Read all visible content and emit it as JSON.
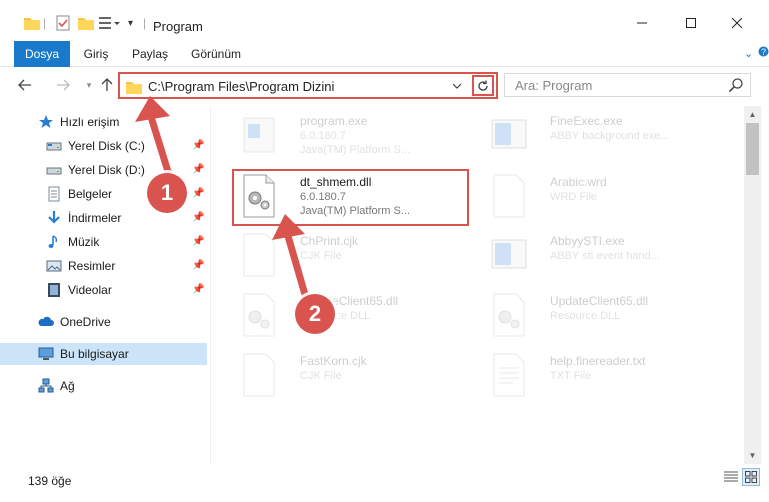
{
  "window": {
    "title": "Program",
    "minimize_icon": "minimize-icon",
    "maximize_icon": "maximize-icon",
    "close_icon": "close-icon"
  },
  "ribbon": {
    "tabs": [
      {
        "label": "Dosya",
        "active": true
      },
      {
        "label": "Giriş",
        "active": false
      },
      {
        "label": "Paylaş",
        "active": false
      },
      {
        "label": "Görünüm",
        "active": false
      }
    ]
  },
  "address": {
    "path": "C:\\Program Files\\Program Dizini",
    "search_placeholder": "Ara: Program"
  },
  "sidebar": {
    "items": [
      {
        "label": "Hızlı erişim",
        "icon": "star-icon",
        "pinned": false
      },
      {
        "label": "Yerel Disk (C:)",
        "icon": "drive-icon",
        "pinned": true
      },
      {
        "label": "Yerel Disk (D:)",
        "icon": "drive-icon",
        "pinned": true
      },
      {
        "label": "Belgeler",
        "icon": "documents-icon",
        "pinned": true
      },
      {
        "label": "İndirmeler",
        "icon": "download-icon",
        "pinned": true
      },
      {
        "label": "Müzik",
        "icon": "music-icon",
        "pinned": true
      },
      {
        "label": "Resimler",
        "icon": "pictures-icon",
        "pinned": true
      },
      {
        "label": "Videolar",
        "icon": "videos-icon",
        "pinned": true
      },
      {
        "label": "OneDrive",
        "icon": "cloud-icon",
        "pinned": false
      },
      {
        "label": "Bu bilgisayar",
        "icon": "computer-icon",
        "pinned": false,
        "selected": true
      },
      {
        "label": "Ağ",
        "icon": "network-icon",
        "pinned": false
      }
    ]
  },
  "files": [
    {
      "name": "program.exe",
      "line1": "6.0.180.7",
      "line2": "Java(TM) Platform S...",
      "faded": true
    },
    {
      "name": "FineExec.exe",
      "line1": "ABBY background exe...",
      "line2": "",
      "faded": true
    },
    {
      "name": "dt_shmem.dll",
      "line1": "6.0.180.7",
      "line2": "Java(TM) Platform S...",
      "faded": false
    },
    {
      "name": "Arabic.wrd",
      "line1": "WRD File",
      "line2": "",
      "faded": true
    },
    {
      "name": "ChPrint.cjk",
      "line1": "CJK File",
      "line2": "",
      "faded": true
    },
    {
      "name": "AbbyySTI.exe",
      "line1": "ABBY sti event hand...",
      "line2": "",
      "faded": true
    },
    {
      "name": "UpdateClient65.dll",
      "line1": "Resource DLL",
      "line2": "",
      "faded": true
    },
    {
      "name": "UpdateClient65.dll",
      "line1": "Resource DLL",
      "line2": "",
      "faded": true
    },
    {
      "name": "FastKorn.cjk",
      "line1": "CJK File",
      "line2": "",
      "faded": true
    },
    {
      "name": "help.finereader.txt",
      "line1": "TXT File",
      "line2": "",
      "faded": true
    }
  ],
  "status": {
    "count": "139 öğe"
  },
  "callouts": [
    "1",
    "2"
  ],
  "colors": {
    "accent": "#1979ca",
    "highlight": "#d9534f",
    "selected": "#cce4f7"
  }
}
